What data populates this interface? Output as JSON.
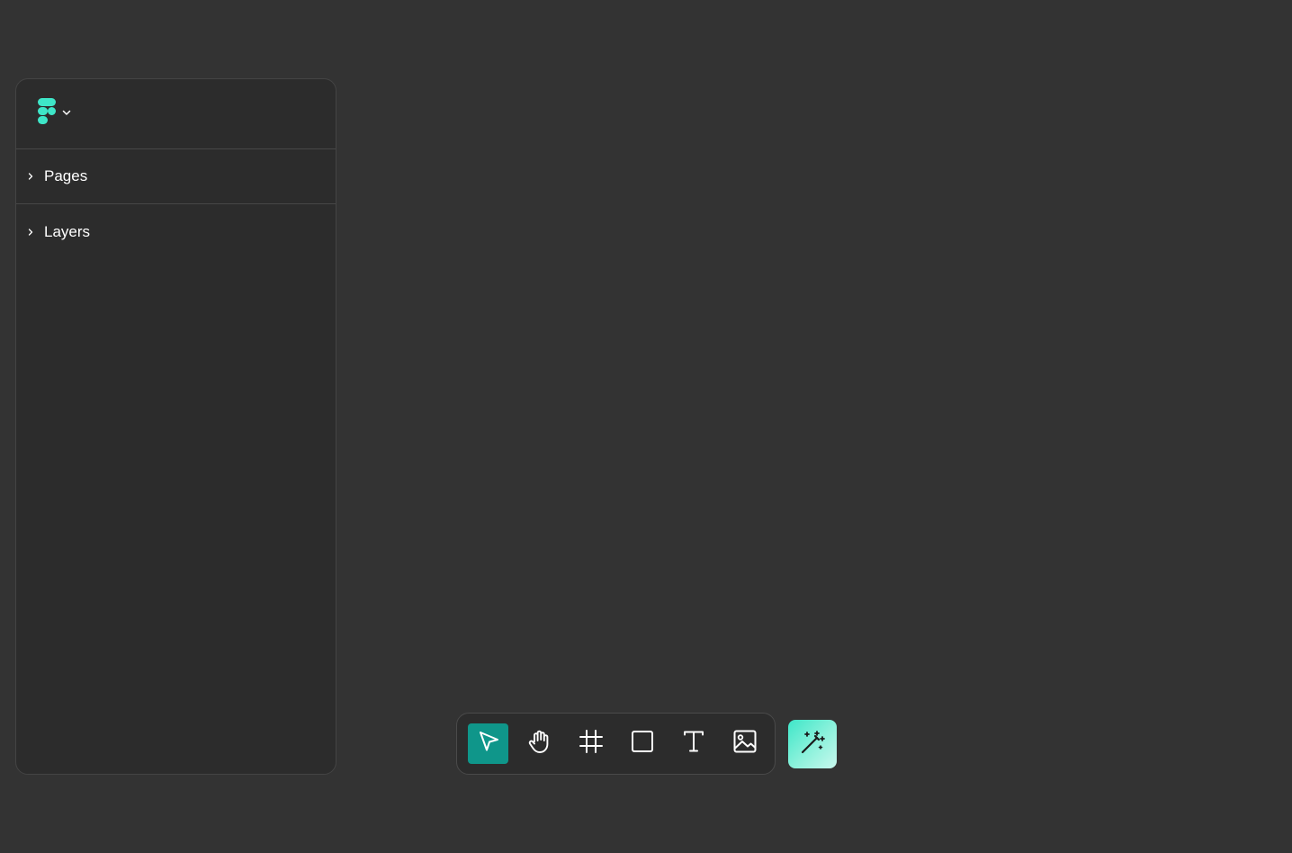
{
  "colors": {
    "background": "#333333",
    "panel": "#2c2c2c",
    "accent": "#0f968a",
    "logo": "#3ee6c8"
  },
  "sidebar": {
    "logo_icon": "figma-logo-icon",
    "menu_icon": "chevron-down-icon",
    "sections": [
      {
        "label": "Pages",
        "icon": "chevron-right-icon"
      },
      {
        "label": "Layers",
        "icon": "chevron-right-icon"
      }
    ]
  },
  "toolbar": {
    "tools": [
      {
        "name": "move",
        "icon": "cursor-arrow-icon",
        "active": true
      },
      {
        "name": "hand",
        "icon": "hand-icon",
        "active": false
      },
      {
        "name": "frame",
        "icon": "frame-icon",
        "active": false
      },
      {
        "name": "rectangle",
        "icon": "square-icon",
        "active": false
      },
      {
        "name": "text",
        "icon": "text-icon",
        "active": false
      },
      {
        "name": "image",
        "icon": "image-icon",
        "active": false
      }
    ],
    "ai_button_icon": "magic-wand-icon"
  }
}
